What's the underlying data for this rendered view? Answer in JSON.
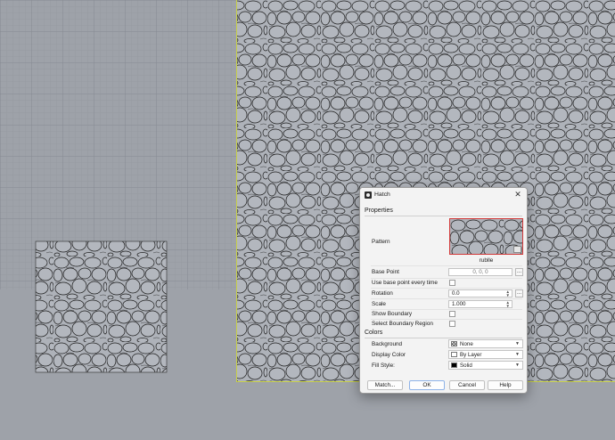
{
  "dialog": {
    "title": "Hatch",
    "close_glyph": "✕",
    "sections": {
      "properties": "Properties",
      "colors": "Colors"
    },
    "pattern": {
      "label": "Pattern",
      "name": "rublle"
    },
    "base_point": {
      "label": "Base Point",
      "value": "0, 0, 0",
      "picker": "..."
    },
    "use_base_point": {
      "label": "Use base point every time",
      "checked": false
    },
    "rotation": {
      "label": "Rotation",
      "value": "0.0",
      "picker": "..."
    },
    "scale": {
      "label": "Scale",
      "value": "1.000"
    },
    "show_boundary": {
      "label": "Show Boundary",
      "checked": false
    },
    "select_boundary": {
      "label": "Select Boundary Region",
      "checked": false
    },
    "background": {
      "label": "Background",
      "value": "None"
    },
    "display_color": {
      "label": "Display Color",
      "value": "By Layer"
    },
    "fill_style": {
      "label": "Fill Style:",
      "value": "Solid"
    },
    "buttons": {
      "match": "Match...",
      "ok": "OK",
      "cancel": "Cancel",
      "help": "Help"
    }
  },
  "icons": {
    "app": "hatch-app-icon",
    "close": "close-icon",
    "spin": "spin-arrows-icon",
    "chevron": "chevron-down-icon"
  },
  "colors": {
    "viewport_bg": "#9ea2a9",
    "grid_line": "#8d9199",
    "stone_fill": "#aeb2b9",
    "stone_stroke": "#1d1d1d",
    "boundary": "#c8d14a",
    "pattern_highlight": "#d23a3a"
  }
}
